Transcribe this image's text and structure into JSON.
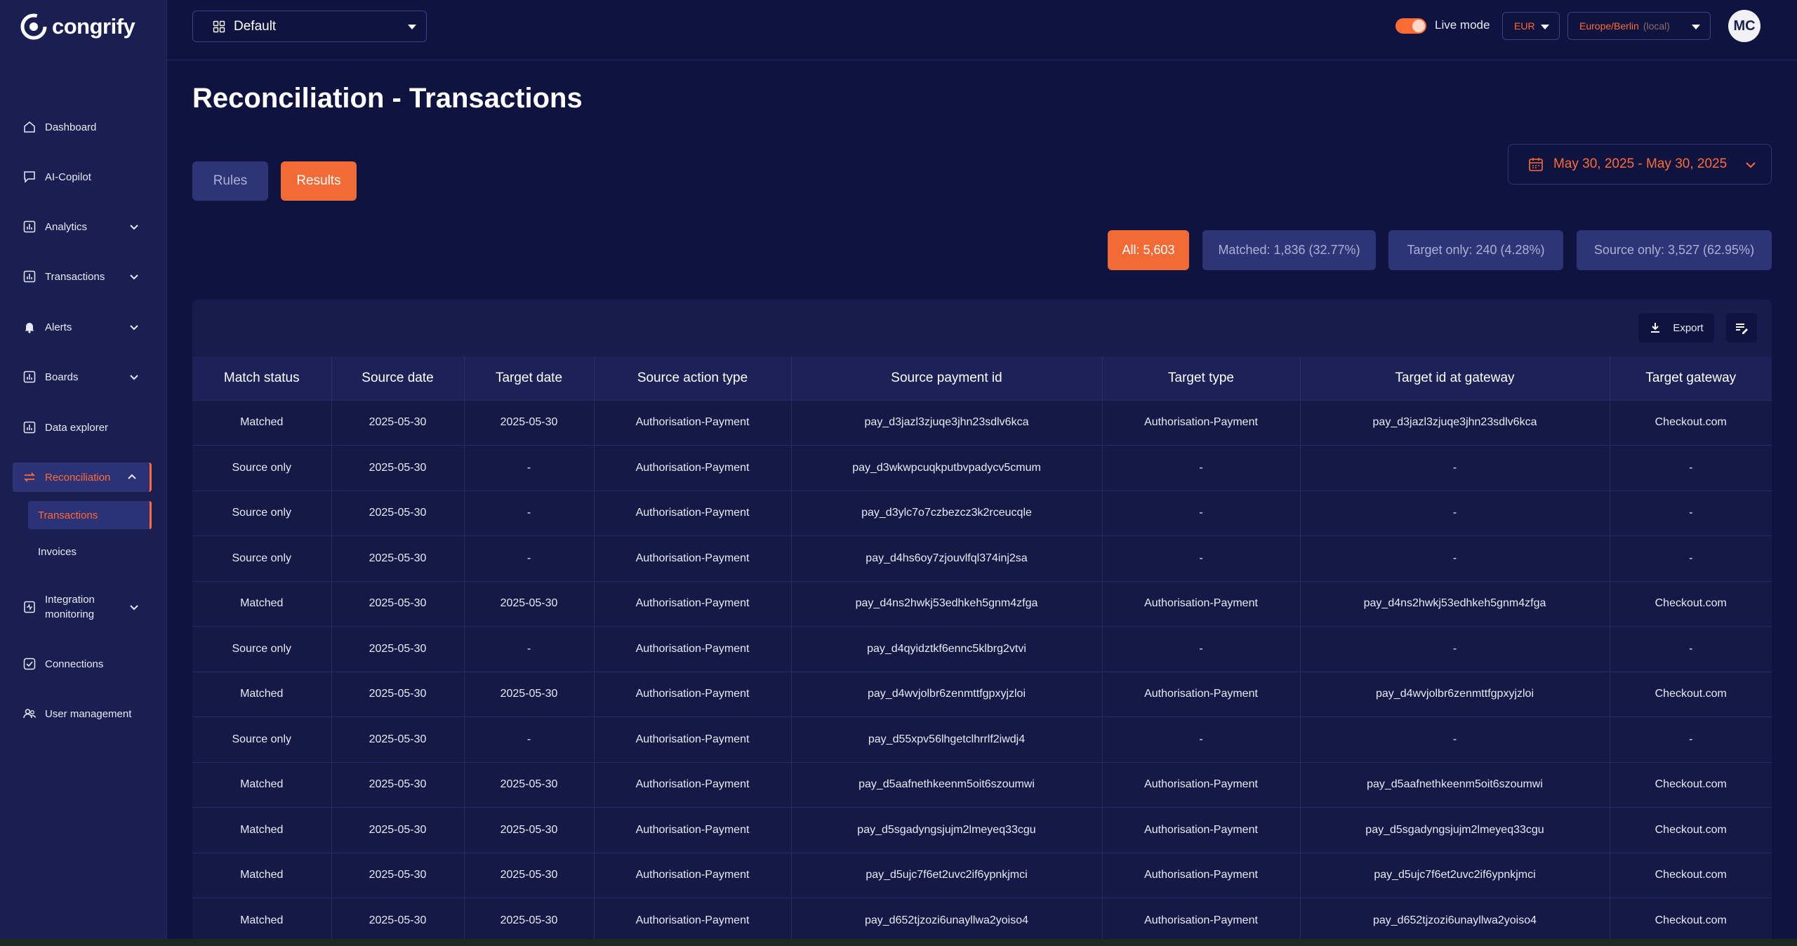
{
  "brand": {
    "name": "congrify"
  },
  "topbar": {
    "board_select": "Default",
    "live_mode_label": "Live mode",
    "live_mode_on": true,
    "currency": "EUR",
    "timezone": "Europe/Berlin",
    "timezone_note": "(local)",
    "avatar_initials": "MC"
  },
  "sidebar": {
    "items": [
      {
        "label": "Dashboard",
        "icon": "home-icon"
      },
      {
        "label": "AI-Copilot",
        "icon": "chat-icon"
      },
      {
        "label": "Analytics",
        "icon": "chart-icon",
        "expandable": true
      },
      {
        "label": "Transactions",
        "icon": "chart-icon",
        "expandable": true
      },
      {
        "label": "Alerts",
        "icon": "bell-icon",
        "expandable": true
      },
      {
        "label": "Boards",
        "icon": "chart-icon",
        "expandable": true
      },
      {
        "label": "Data explorer",
        "icon": "chart-icon"
      },
      {
        "label": "Reconciliation",
        "icon": "swap-icon",
        "expandable": true,
        "active": true
      },
      {
        "label": "Integration monitoring",
        "icon": "monitor-icon",
        "expandable": true
      },
      {
        "label": "Connections",
        "icon": "check-icon"
      },
      {
        "label": "User management",
        "icon": "users-icon"
      }
    ],
    "reconciliation_sub": [
      {
        "label": "Transactions",
        "active": true
      },
      {
        "label": "Invoices"
      }
    ]
  },
  "main": {
    "title": "Reconciliation - Transactions",
    "tabs": [
      {
        "label": "Rules",
        "active": false
      },
      {
        "label": "Results",
        "active": true
      }
    ],
    "date_range": "May 30, 2025 - May 30, 2025",
    "filters": [
      {
        "label": "All: 5,603",
        "active": true
      },
      {
        "label": "Matched: 1,836 (32.77%)"
      },
      {
        "label": "Target only: 240 (4.28%)"
      },
      {
        "label": "Source only: 3,527 (62.95%)"
      }
    ],
    "export_label": "Export",
    "table": {
      "columns": [
        "Match status",
        "Source date",
        "Target date",
        "Source action type",
        "Source payment id",
        "Target type",
        "Target id at gateway",
        "Target gateway"
      ],
      "rows": [
        [
          "Matched",
          "2025-05-30",
          "2025-05-30",
          "Authorisation-Payment",
          "pay_d3jazl3zjuqe3jhn23sdlv6kca",
          "Authorisation-Payment",
          "pay_d3jazl3zjuqe3jhn23sdlv6kca",
          "Checkout.com"
        ],
        [
          "Source only",
          "2025-05-30",
          "-",
          "Authorisation-Payment",
          "pay_d3wkwpcuqkputbvpadycv5cmum",
          "-",
          "-",
          "-"
        ],
        [
          "Source only",
          "2025-05-30",
          "-",
          "Authorisation-Payment",
          "pay_d3ylc7o7czbezcz3k2rceucqle",
          "-",
          "-",
          "-"
        ],
        [
          "Source only",
          "2025-05-30",
          "-",
          "Authorisation-Payment",
          "pay_d4hs6oy7zjouvlfql374inj2sa",
          "-",
          "-",
          "-"
        ],
        [
          "Matched",
          "2025-05-30",
          "2025-05-30",
          "Authorisation-Payment",
          "pay_d4ns2hwkj53edhkeh5gnm4zfga",
          "Authorisation-Payment",
          "pay_d4ns2hwkj53edhkeh5gnm4zfga",
          "Checkout.com"
        ],
        [
          "Source only",
          "2025-05-30",
          "-",
          "Authorisation-Payment",
          "pay_d4qyidztkf6ennc5klbrg2vtvi",
          "-",
          "-",
          "-"
        ],
        [
          "Matched",
          "2025-05-30",
          "2025-05-30",
          "Authorisation-Payment",
          "pay_d4wvjolbr6zenmttfgpxyjzloi",
          "Authorisation-Payment",
          "pay_d4wvjolbr6zenmttfgpxyjzloi",
          "Checkout.com"
        ],
        [
          "Source only",
          "2025-05-30",
          "-",
          "Authorisation-Payment",
          "pay_d55xpv56lhgetclhrrlf2iwdj4",
          "-",
          "-",
          "-"
        ],
        [
          "Matched",
          "2025-05-30",
          "2025-05-30",
          "Authorisation-Payment",
          "pay_d5aafnethkeenm5oit6szoumwi",
          "Authorisation-Payment",
          "pay_d5aafnethkeenm5oit6szoumwi",
          "Checkout.com"
        ],
        [
          "Matched",
          "2025-05-30",
          "2025-05-30",
          "Authorisation-Payment",
          "pay_d5sgadyngsjujm2lmeyeq33cgu",
          "Authorisation-Payment",
          "pay_d5sgadyngsjujm2lmeyeq33cgu",
          "Checkout.com"
        ],
        [
          "Matched",
          "2025-05-30",
          "2025-05-30",
          "Authorisation-Payment",
          "pay_d5ujc7f6et2uvc2if6ypnkjmci",
          "Authorisation-Payment",
          "pay_d5ujc7f6et2uvc2if6ypnkjmci",
          "Checkout.com"
        ],
        [
          "Matched",
          "2025-05-30",
          "2025-05-30",
          "Authorisation-Payment",
          "pay_d652tjzozi6unayllwa2yoiso4",
          "Authorisation-Payment",
          "pay_d652tjzozi6unayllwa2yoiso4",
          "Checkout.com"
        ]
      ]
    }
  },
  "colors": {
    "accent": "#f26a35",
    "background": "#0f1340",
    "sidebar": "#1a1f52"
  }
}
